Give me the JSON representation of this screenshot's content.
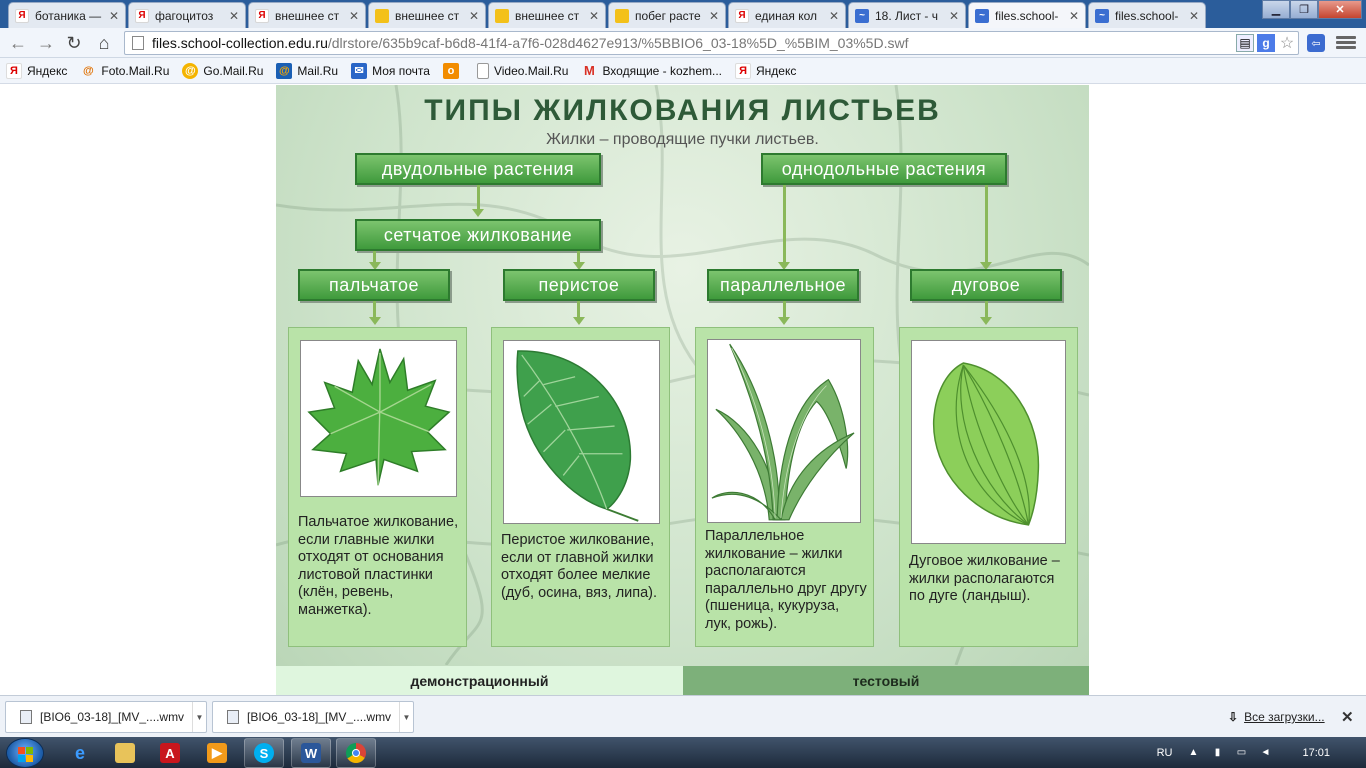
{
  "browser": {
    "tabs": [
      {
        "label": "ботаника — ",
        "icon": "yandex-icon"
      },
      {
        "label": "фагоцитоз",
        "icon": "yandex-icon"
      },
      {
        "label": "внешнее ст",
        "icon": "yandex-icon"
      },
      {
        "label": "внешнее ст",
        "icon": "document-icon"
      },
      {
        "label": "внешнее ст",
        "icon": "document-icon"
      },
      {
        "label": "побег расте",
        "icon": "document-icon"
      },
      {
        "label": "единая кол",
        "icon": "yandex-icon"
      },
      {
        "label": "18. Лист - ч",
        "icon": "school-collection-icon"
      },
      {
        "label": "files.school-",
        "icon": "school-collection-icon",
        "active": true
      },
      {
        "label": "files.school-",
        "icon": "school-collection-icon"
      }
    ],
    "address": {
      "host": "files.school-collection.edu.ru",
      "path": "/dlrstore/635b9caf-b6d8-41f4-a7f6-028d4627e913/%5BBIO6_03-18%5D_%5BIM_03%5D.swf"
    },
    "bookmarks": [
      {
        "label": "Яндекс",
        "icon": "yandex-icon"
      },
      {
        "label": "Foto.Mail.Ru",
        "icon": "mailru-icon"
      },
      {
        "label": "Go.Mail.Ru",
        "icon": "search-icon"
      },
      {
        "label": "Mail.Ru",
        "icon": "mailru-icon"
      },
      {
        "label": "Моя почта",
        "icon": "mail-icon"
      },
      {
        "label": "",
        "icon": "odnoklassniki-icon"
      },
      {
        "label": "Video.Mail.Ru",
        "icon": "page-icon"
      },
      {
        "label": "Входящие - kozhem...",
        "icon": "gmail-icon"
      },
      {
        "label": "Яндекс",
        "icon": "yandex-icon"
      }
    ]
  },
  "slide": {
    "title": "ТИПЫ  ЖИЛКОВАНИЯ  ЛИСТЬЕВ",
    "subtitle": "Жилки – проводящие пучки листьев.",
    "groups": {
      "dicot": "двудольные  растения",
      "monocot": "однодольные  растения",
      "reticulate": "сетчатое  жилкование"
    },
    "types": [
      {
        "label": "пальчатое",
        "description": "Пальчатое жилкование, если главные жилки отходят от основания листовой пластинки (клён, ревень, манжетка)."
      },
      {
        "label": "перистое",
        "description": "Перистое жилкование, если от главной жилки отходят более мелкие (дуб, осина, вяз, липа)."
      },
      {
        "label": "параллельное",
        "description": "Параллельное жилкование – жилки располагаются параллельно друг другу (пшеница, кукуруза, лук, рожь)."
      },
      {
        "label": "дуговое",
        "description": "Дуговое жилкование – жилки располагаются по дуге (ландыш)."
      }
    ],
    "modes": {
      "demo": "демонстрационный",
      "test": "тестовый"
    },
    "colors": {
      "accent": "#4ea547",
      "text": "#2e5a38",
      "card": "#b9e3a8"
    }
  },
  "downloads": {
    "items": [
      "[BIO6_03-18]_[MV_....wmv",
      "[BIO6_03-18]_[MV_....wmv"
    ],
    "all_label": "Все загрузки..."
  },
  "taskbar": {
    "apps": [
      "internet-explorer-icon",
      "explorer-folder-icon",
      "acrobat-icon",
      "media-player-icon",
      "skype-icon",
      "word-icon",
      "chrome-icon"
    ],
    "language": "RU",
    "time": "17:01"
  }
}
